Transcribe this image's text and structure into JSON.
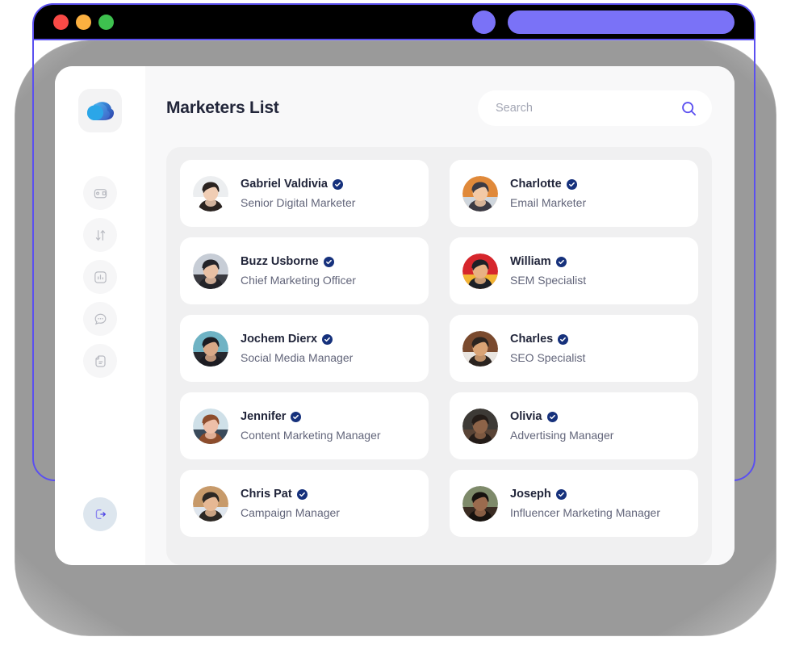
{
  "browser": {
    "traffic_lights": [
      {
        "name": "close",
        "color": "#f94a46"
      },
      {
        "name": "minimize",
        "color": "#fbb040"
      },
      {
        "name": "maximize",
        "color": "#3ec14f"
      }
    ],
    "accent_color": "#7a72f7",
    "frame_color": "#5b50f0",
    "titlebar_color": "#000000"
  },
  "sidebar": {
    "logo_name": "cloud-logo",
    "items": [
      {
        "icon": "wallet-icon",
        "name": "wallet"
      },
      {
        "icon": "transfer-icon",
        "name": "transfer"
      },
      {
        "icon": "analytics-icon",
        "name": "analytics"
      },
      {
        "icon": "chat-icon",
        "name": "messages"
      },
      {
        "icon": "document-icon",
        "name": "documents"
      }
    ],
    "logout": {
      "icon": "logout-icon",
      "name": "logout"
    }
  },
  "header": {
    "title": "Marketers List"
  },
  "search": {
    "placeholder": "Search",
    "value": "",
    "icon": "search-icon",
    "icon_color": "#5b50f0"
  },
  "verified_badge": {
    "icon": "verified-check-icon",
    "color": "#16317c"
  },
  "marketers": [
    {
      "name": "Gabriel Valdivia",
      "role": "Senior Digital Marketer",
      "verified": true,
      "avatar": "avatar-gabriel"
    },
    {
      "name": "Charlotte",
      "role": "Email Marketer",
      "verified": true,
      "avatar": "avatar-charlotte"
    },
    {
      "name": "Buzz Usborne",
      "role": "Chief Marketing Officer",
      "verified": true,
      "avatar": "avatar-buzz"
    },
    {
      "name": "William",
      "role": "SEM Specialist",
      "verified": true,
      "avatar": "avatar-william"
    },
    {
      "name": "Jochem Dierx",
      "role": "Social Media Manager",
      "verified": true,
      "avatar": "avatar-jochem"
    },
    {
      "name": "Charles",
      "role": "SEO Specialist",
      "verified": true,
      "avatar": "avatar-charles"
    },
    {
      "name": "Jennifer",
      "role": "Content Marketing Manager",
      "verified": true,
      "avatar": "avatar-jennifer"
    },
    {
      "name": "Olivia",
      "role": "Advertising Manager",
      "verified": true,
      "avatar": "avatar-olivia"
    },
    {
      "name": "Chris Pat",
      "role": "Campaign Manager",
      "verified": true,
      "avatar": "avatar-chris"
    },
    {
      "name": "Joseph",
      "role": "Influencer Marketing Manager",
      "verified": true,
      "avatar": "avatar-joseph"
    }
  ]
}
